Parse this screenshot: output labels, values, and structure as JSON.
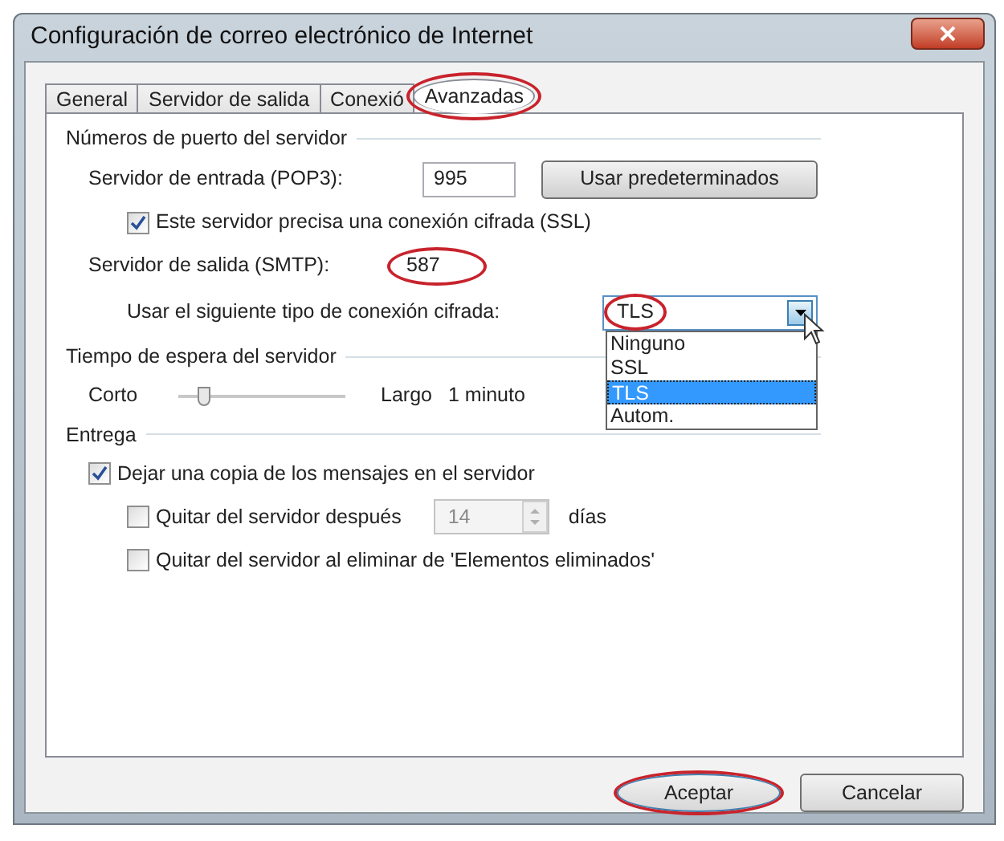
{
  "window": {
    "title": "Configuración de correo electrónico de Internet"
  },
  "tabs": [
    {
      "label": "General",
      "selected": false,
      "circled": false
    },
    {
      "label": "Servidor de salida",
      "selected": false,
      "circled": false
    },
    {
      "label": "Conexió",
      "selected": false,
      "circled": false
    },
    {
      "label": "Avanzadas",
      "selected": true,
      "circled": true
    }
  ],
  "ports": {
    "heading": "Números de puerto del servidor",
    "incoming": {
      "label": "Servidor de entrada (POP3):",
      "value": "995"
    },
    "defaults_button": "Usar predeterminados",
    "ssl": {
      "label": "Este servidor precisa una conexión cifrada (SSL)",
      "checked": true
    },
    "outgoing": {
      "label": "Servidor de salida (SMTP):",
      "value": "587",
      "circled": true
    },
    "encryption": {
      "label": "Usar el siguiente tipo de conexión cifrada:",
      "value": "TLS",
      "circled": true,
      "expanded": true,
      "options": [
        {
          "label": "Ninguno",
          "selected": false
        },
        {
          "label": "SSL",
          "selected": false
        },
        {
          "label": "TLS",
          "selected": true
        },
        {
          "label": "Autom.",
          "selected": false
        }
      ]
    }
  },
  "timeout": {
    "heading": "Tiempo de espera del servidor",
    "short_label": "Corto",
    "long_label": "Largo",
    "reading": "1 minuto",
    "level": 0.12
  },
  "delivery": {
    "heading": "Entrega",
    "items": [
      {
        "kind": "checkbox",
        "label": "Dejar una copia de los mensajes en el servidor",
        "checked": true,
        "children": [
          {
            "kind": "spinner",
            "label": "Quitar del servidor después",
            "checked": false,
            "value": "14",
            "unit": "días",
            "disabled": true
          },
          {
            "kind": "checkbox",
            "label": "Quitar del servidor al eliminar de 'Elementos eliminados'",
            "checked": false
          }
        ]
      }
    ]
  },
  "buttons": [
    {
      "label": "Aceptar",
      "circled": true,
      "default": true
    },
    {
      "label": "Cancelar",
      "circled": false,
      "default": false
    }
  ]
}
